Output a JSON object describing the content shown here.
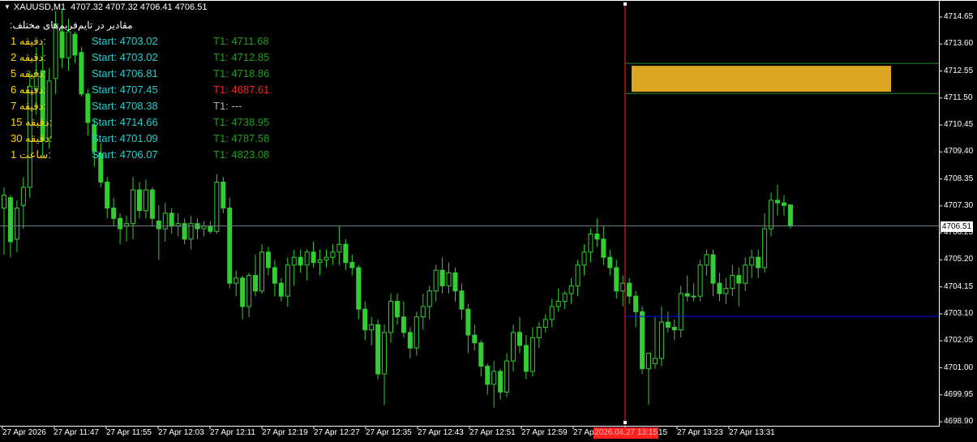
{
  "header": {
    "symbol": "XAUUSD,M1",
    "ohlc": "4707.32 4707.32 4706.41 4706.51"
  },
  "panel": {
    "title": "مقادیر در تایم‌فریم‌های مختلف:",
    "rows": [
      {
        "tf": "1 دقیقه:",
        "start": "Start: 4703.02",
        "t1": "T1: 4711.68",
        "t1_color": "#1e9e1e"
      },
      {
        "tf": "2 دقیقه:",
        "start": "Start: 4703.02",
        "t1": "T1: 4712.85",
        "t1_color": "#1e9e1e"
      },
      {
        "tf": "5 دقیقه:",
        "start": "Start: 4706.81",
        "t1": "T1: 4718.86",
        "t1_color": "#1e9e1e"
      },
      {
        "tf": "6 دقیقه:",
        "start": "Start: 4707.45",
        "t1": "T1: 4687.61",
        "t1_color": "#ff2020"
      },
      {
        "tf": "7 دقیقه:",
        "start": "Start: 4708.38",
        "t1": "T1: ---",
        "t1_color": "#b0b0b0"
      },
      {
        "tf": "15 دقیقه:",
        "start": "Start: 4714.66",
        "t1": "T1: 4738.95",
        "t1_color": "#1e9e1e"
      },
      {
        "tf": "30 دقیقه:",
        "start": "Start: 4701.09",
        "t1": "T1: 4787.58",
        "t1_color": "#1e9e1e"
      },
      {
        "tf": "1 ساعت:",
        "start": "Start: 4706.07",
        "t1": "T1: 4823.08",
        "t1_color": "#1e9e1e"
      }
    ]
  },
  "price_axis": {
    "labels": [
      "4714.65",
      "4713.60",
      "4712.55",
      "4711.50",
      "4710.45",
      "4709.40",
      "4708.35",
      "4707.30",
      "4706.25",
      "4705.20",
      "4704.15",
      "4703.10",
      "4702.05",
      "4701.00",
      "4699.95",
      "4698.90"
    ],
    "current_price": "4706.51",
    "current_value": 4706.51
  },
  "time_axis": {
    "labels": [
      "27 Apr 2026",
      "27 Apr 11:47",
      "27 Apr 11:55",
      "27 Apr 12:03",
      "27 Apr 12:11",
      "27 Apr 12:19",
      "27 Apr 12:27",
      "27 Apr 12:35",
      "27 Apr 12:43",
      "27 Apr 12:51",
      "27 Apr 12:59",
      "27 Apr 13:07",
      "27 Apr 13:15",
      "27 Apr 13:23",
      "27 Apr 13:31"
    ],
    "visible_labels": [
      "27 Apr 2026",
      "27 Apr 11:47",
      "27 Apr 11:55",
      "27 Apr 12:03",
      "27 Apr 12:11",
      "27 Apr 12:19",
      "27 Apr 12:27",
      "27 Apr 12:35",
      "27 Apr 12:43",
      "27 Apr 12:51",
      "27 Apr 12:59",
      "27 Apr",
      "15",
      "27 Apr 13:23",
      "27 Apr 13:31"
    ],
    "highlight_date": "2026.04.27 13:15"
  },
  "levels": {
    "box_top": 4712.78,
    "box_bottom": 4711.62,
    "blue_line": 4703.02
  },
  "colors": {
    "background": "#000000",
    "bull": "#32cd32",
    "bear": "#32cd32",
    "box": "#daa520",
    "box_border": "#228b22",
    "blue_line": "#0000ff",
    "current_line": "#708090",
    "vertical_line": "#ff2020"
  },
  "chart_data": {
    "type": "candlestick",
    "ylim": [
      4698.8,
      4715.1
    ],
    "candles": [
      {
        "o": 4707.2,
        "h": 4708.0,
        "l": 4705.4,
        "c": 4707.7
      },
      {
        "o": 4707.6,
        "h": 4707.7,
        "l": 4705.3,
        "c": 4705.9
      },
      {
        "o": 4706.0,
        "h": 4707.5,
        "l": 4705.5,
        "c": 4707.2
      },
      {
        "o": 4707.3,
        "h": 4708.4,
        "l": 4706.4,
        "c": 4708.0
      },
      {
        "o": 4708.0,
        "h": 4712.5,
        "l": 4707.6,
        "c": 4711.9
      },
      {
        "o": 4711.8,
        "h": 4713.4,
        "l": 4710.8,
        "c": 4712.4
      },
      {
        "o": 4712.5,
        "h": 4713.5,
        "l": 4709.2,
        "c": 4709.8
      },
      {
        "o": 4709.9,
        "h": 4712.6,
        "l": 4709.5,
        "c": 4712.1
      },
      {
        "o": 4712.2,
        "h": 4714.8,
        "l": 4711.6,
        "c": 4714.3
      },
      {
        "o": 4714.0,
        "h": 4714.9,
        "l": 4712.6,
        "c": 4713.0
      },
      {
        "o": 4713.0,
        "h": 4714.5,
        "l": 4712.5,
        "c": 4714.0
      },
      {
        "o": 4713.9,
        "h": 4714.0,
        "l": 4712.8,
        "c": 4713.1
      },
      {
        "o": 4713.2,
        "h": 4713.4,
        "l": 4711.5,
        "c": 4711.6
      },
      {
        "o": 4711.6,
        "h": 4711.8,
        "l": 4710.0,
        "c": 4710.5
      },
      {
        "o": 4710.4,
        "h": 4710.6,
        "l": 4708.8,
        "c": 4709.4
      },
      {
        "o": 4709.3,
        "h": 4709.7,
        "l": 4708.0,
        "c": 4708.2
      },
      {
        "o": 4708.2,
        "h": 4708.4,
        "l": 4706.8,
        "c": 4707.2
      },
      {
        "o": 4707.2,
        "h": 4707.6,
        "l": 4706.5,
        "c": 4706.8
      },
      {
        "o": 4706.8,
        "h": 4707.0,
        "l": 4705.8,
        "c": 4706.4
      },
      {
        "o": 4706.5,
        "h": 4706.9,
        "l": 4705.9,
        "c": 4706.6
      },
      {
        "o": 4706.6,
        "h": 4708.4,
        "l": 4706.0,
        "c": 4707.9
      },
      {
        "o": 4707.9,
        "h": 4708.2,
        "l": 4706.8,
        "c": 4707.1
      },
      {
        "o": 4707.1,
        "h": 4708.3,
        "l": 4706.8,
        "c": 4707.9
      },
      {
        "o": 4707.9,
        "h": 4708.0,
        "l": 4706.5,
        "c": 4706.8
      },
      {
        "o": 4706.7,
        "h": 4707.3,
        "l": 4705.2,
        "c": 4706.4
      },
      {
        "o": 4706.4,
        "h": 4707.4,
        "l": 4705.9,
        "c": 4707.0
      },
      {
        "o": 4707.0,
        "h": 4707.2,
        "l": 4706.2,
        "c": 4706.5
      },
      {
        "o": 4706.5,
        "h": 4707.0,
        "l": 4706.1,
        "c": 4706.6
      },
      {
        "o": 4706.6,
        "h": 4706.8,
        "l": 4705.8,
        "c": 4706.0
      },
      {
        "o": 4706.0,
        "h": 4706.9,
        "l": 4705.6,
        "c": 4706.6
      },
      {
        "o": 4706.6,
        "h": 4706.8,
        "l": 4706.0,
        "c": 4706.4
      },
      {
        "o": 4706.4,
        "h": 4706.7,
        "l": 4706.1,
        "c": 4706.5
      },
      {
        "o": 4706.5,
        "h": 4706.7,
        "l": 4706.2,
        "c": 4706.3
      },
      {
        "o": 4706.3,
        "h": 4708.5,
        "l": 4706.2,
        "c": 4708.2
      },
      {
        "o": 4708.2,
        "h": 4708.4,
        "l": 4707.0,
        "c": 4707.2
      },
      {
        "o": 4707.2,
        "h": 4707.6,
        "l": 4704.1,
        "c": 4704.3
      },
      {
        "o": 4704.3,
        "h": 4704.8,
        "l": 4703.8,
        "c": 4704.5
      },
      {
        "o": 4704.5,
        "h": 4704.6,
        "l": 4702.9,
        "c": 4703.4
      },
      {
        "o": 4703.4,
        "h": 4704.7,
        "l": 4703.0,
        "c": 4704.6
      },
      {
        "o": 4704.6,
        "h": 4705.4,
        "l": 4703.8,
        "c": 4704.0
      },
      {
        "o": 4704.0,
        "h": 4705.8,
        "l": 4703.9,
        "c": 4705.5
      },
      {
        "o": 4705.5,
        "h": 4705.7,
        "l": 4704.6,
        "c": 4704.9
      },
      {
        "o": 4704.9,
        "h": 4705.2,
        "l": 4703.8,
        "c": 4704.3
      },
      {
        "o": 4704.3,
        "h": 4704.5,
        "l": 4703.6,
        "c": 4703.8
      },
      {
        "o": 4703.8,
        "h": 4705.3,
        "l": 4703.4,
        "c": 4705.0
      },
      {
        "o": 4705.0,
        "h": 4705.6,
        "l": 4704.2,
        "c": 4705.3
      },
      {
        "o": 4705.3,
        "h": 4705.6,
        "l": 4704.7,
        "c": 4705.0
      },
      {
        "o": 4705.0,
        "h": 4705.6,
        "l": 4704.4,
        "c": 4705.5
      },
      {
        "o": 4705.5,
        "h": 4705.9,
        "l": 4704.9,
        "c": 4705.1
      },
      {
        "o": 4705.1,
        "h": 4705.6,
        "l": 4704.6,
        "c": 4705.2
      },
      {
        "o": 4705.2,
        "h": 4705.6,
        "l": 4704.9,
        "c": 4705.3
      },
      {
        "o": 4705.3,
        "h": 4705.8,
        "l": 4705.0,
        "c": 4705.5
      },
      {
        "o": 4705.5,
        "h": 4706.5,
        "l": 4705.0,
        "c": 4705.8
      },
      {
        "o": 4705.8,
        "h": 4706.0,
        "l": 4704.8,
        "c": 4705.1
      },
      {
        "o": 4705.1,
        "h": 4705.4,
        "l": 4704.6,
        "c": 4704.9
      },
      {
        "o": 4704.9,
        "h": 4705.0,
        "l": 4702.9,
        "c": 4703.3
      },
      {
        "o": 4703.3,
        "h": 4703.6,
        "l": 4702.1,
        "c": 4702.5
      },
      {
        "o": 4702.5,
        "h": 4703.0,
        "l": 4701.9,
        "c": 4702.7
      },
      {
        "o": 4702.7,
        "h": 4702.9,
        "l": 4700.6,
        "c": 4700.8
      },
      {
        "o": 4700.8,
        "h": 4702.7,
        "l": 4699.6,
        "c": 4702.4
      },
      {
        "o": 4702.4,
        "h": 4703.9,
        "l": 4702.0,
        "c": 4703.6
      },
      {
        "o": 4703.6,
        "h": 4703.9,
        "l": 4702.7,
        "c": 4703.0
      },
      {
        "o": 4703.0,
        "h": 4703.6,
        "l": 4702.2,
        "c": 4702.4
      },
      {
        "o": 4702.4,
        "h": 4702.6,
        "l": 4701.4,
        "c": 4701.8
      },
      {
        "o": 4701.8,
        "h": 4703.2,
        "l": 4701.5,
        "c": 4703.0
      },
      {
        "o": 4703.0,
        "h": 4703.9,
        "l": 4702.5,
        "c": 4703.4
      },
      {
        "o": 4703.4,
        "h": 4704.2,
        "l": 4702.9,
        "c": 4704.0
      },
      {
        "o": 4704.0,
        "h": 4705.0,
        "l": 4703.6,
        "c": 4704.8
      },
      {
        "o": 4704.8,
        "h": 4705.3,
        "l": 4703.9,
        "c": 4704.2
      },
      {
        "o": 4704.2,
        "h": 4705.1,
        "l": 4703.9,
        "c": 4704.7
      },
      {
        "o": 4704.7,
        "h": 4704.9,
        "l": 4703.6,
        "c": 4704.0
      },
      {
        "o": 4704.0,
        "h": 4704.3,
        "l": 4702.9,
        "c": 4703.3
      },
      {
        "o": 4703.3,
        "h": 4703.5,
        "l": 4701.6,
        "c": 4702.3
      },
      {
        "o": 4702.3,
        "h": 4702.7,
        "l": 4701.7,
        "c": 4702.0
      },
      {
        "o": 4702.0,
        "h": 4702.1,
        "l": 4700.7,
        "c": 4701.1
      },
      {
        "o": 4701.1,
        "h": 4701.2,
        "l": 4700.0,
        "c": 4700.4
      },
      {
        "o": 4700.4,
        "h": 4701.3,
        "l": 4699.5,
        "c": 4700.9
      },
      {
        "o": 4700.9,
        "h": 4701.0,
        "l": 4699.8,
        "c": 4700.1
      },
      {
        "o": 4700.1,
        "h": 4701.6,
        "l": 4699.9,
        "c": 4701.3
      },
      {
        "o": 4701.3,
        "h": 4702.7,
        "l": 4700.9,
        "c": 4702.4
      },
      {
        "o": 4702.4,
        "h": 4703.0,
        "l": 4701.6,
        "c": 4701.9
      },
      {
        "o": 4701.9,
        "h": 4702.3,
        "l": 4700.6,
        "c": 4700.9
      },
      {
        "o": 4700.9,
        "h": 4702.6,
        "l": 4700.7,
        "c": 4702.2
      },
      {
        "o": 4702.2,
        "h": 4702.8,
        "l": 4701.8,
        "c": 4702.6
      },
      {
        "o": 4702.6,
        "h": 4703.1,
        "l": 4702.4,
        "c": 4702.9
      },
      {
        "o": 4702.9,
        "h": 4703.7,
        "l": 4702.6,
        "c": 4703.4
      },
      {
        "o": 4703.4,
        "h": 4704.1,
        "l": 4703.2,
        "c": 4703.6
      },
      {
        "o": 4703.6,
        "h": 4704.0,
        "l": 4703.3,
        "c": 4703.9
      },
      {
        "o": 4703.9,
        "h": 4704.5,
        "l": 4703.5,
        "c": 4704.2
      },
      {
        "o": 4704.2,
        "h": 4705.2,
        "l": 4703.8,
        "c": 4705.0
      },
      {
        "o": 4705.0,
        "h": 4705.8,
        "l": 4704.6,
        "c": 4705.5
      },
      {
        "o": 4705.5,
        "h": 4706.4,
        "l": 4705.1,
        "c": 4706.2
      },
      {
        "o": 4706.2,
        "h": 4706.8,
        "l": 4705.7,
        "c": 4706.0
      },
      {
        "o": 4706.0,
        "h": 4706.5,
        "l": 4705.0,
        "c": 4705.3
      },
      {
        "o": 4705.3,
        "h": 4705.6,
        "l": 4704.6,
        "c": 4704.9
      },
      {
        "o": 4704.9,
        "h": 4705.2,
        "l": 4703.7,
        "c": 4704.0
      },
      {
        "o": 4704.0,
        "h": 4704.6,
        "l": 4703.4,
        "c": 4704.3
      },
      {
        "o": 4704.3,
        "h": 4704.5,
        "l": 4703.5,
        "c": 4703.8
      },
      {
        "o": 4703.8,
        "h": 4704.0,
        "l": 4702.6,
        "c": 4703.2
      },
      {
        "o": 4703.2,
        "h": 4703.4,
        "l": 4700.8,
        "c": 4701.0
      },
      {
        "o": 4701.0,
        "h": 4701.6,
        "l": 4699.6,
        "c": 4701.6
      },
      {
        "o": 4701.2,
        "h": 4703.0,
        "l": 4701.0,
        "c": 4701.4
      },
      {
        "o": 4701.4,
        "h": 4703.4,
        "l": 4701.1,
        "c": 4702.8
      },
      {
        "o": 4702.8,
        "h": 4703.2,
        "l": 4702.4,
        "c": 4702.6
      },
      {
        "o": 4702.6,
        "h": 4702.9,
        "l": 4702.1,
        "c": 4702.5
      },
      {
        "o": 4702.5,
        "h": 4704.2,
        "l": 4702.2,
        "c": 4703.9
      },
      {
        "o": 4703.9,
        "h": 4704.6,
        "l": 4703.6,
        "c": 4703.8
      },
      {
        "o": 4703.8,
        "h": 4704.3,
        "l": 4703.6,
        "c": 4703.8
      },
      {
        "o": 4703.8,
        "h": 4705.2,
        "l": 4703.6,
        "c": 4705.0
      },
      {
        "o": 4705.0,
        "h": 4705.6,
        "l": 4704.6,
        "c": 4705.4
      },
      {
        "o": 4705.4,
        "h": 4705.6,
        "l": 4703.8,
        "c": 4704.3
      },
      {
        "o": 4704.3,
        "h": 4704.7,
        "l": 4703.6,
        "c": 4703.9
      },
      {
        "o": 4703.9,
        "h": 4704.5,
        "l": 4703.5,
        "c": 4704.1
      },
      {
        "o": 4704.1,
        "h": 4705.0,
        "l": 4703.8,
        "c": 4704.6
      },
      {
        "o": 4704.6,
        "h": 4704.9,
        "l": 4703.4,
        "c": 4704.3
      },
      {
        "o": 4704.3,
        "h": 4705.3,
        "l": 4704.0,
        "c": 4705.0
      },
      {
        "o": 4705.0,
        "h": 4705.6,
        "l": 4704.5,
        "c": 4705.3
      },
      {
        "o": 4705.3,
        "h": 4705.6,
        "l": 4704.5,
        "c": 4704.9
      },
      {
        "o": 4704.9,
        "h": 4707.0,
        "l": 4704.7,
        "c": 4706.4
      },
      {
        "o": 4706.4,
        "h": 4707.8,
        "l": 4706.1,
        "c": 4707.5
      },
      {
        "o": 4707.5,
        "h": 4708.1,
        "l": 4706.9,
        "c": 4707.4
      },
      {
        "o": 4707.4,
        "h": 4707.7,
        "l": 4706.9,
        "c": 4707.3
      },
      {
        "o": 4707.32,
        "h": 4707.32,
        "l": 4706.41,
        "c": 4706.51
      }
    ]
  }
}
